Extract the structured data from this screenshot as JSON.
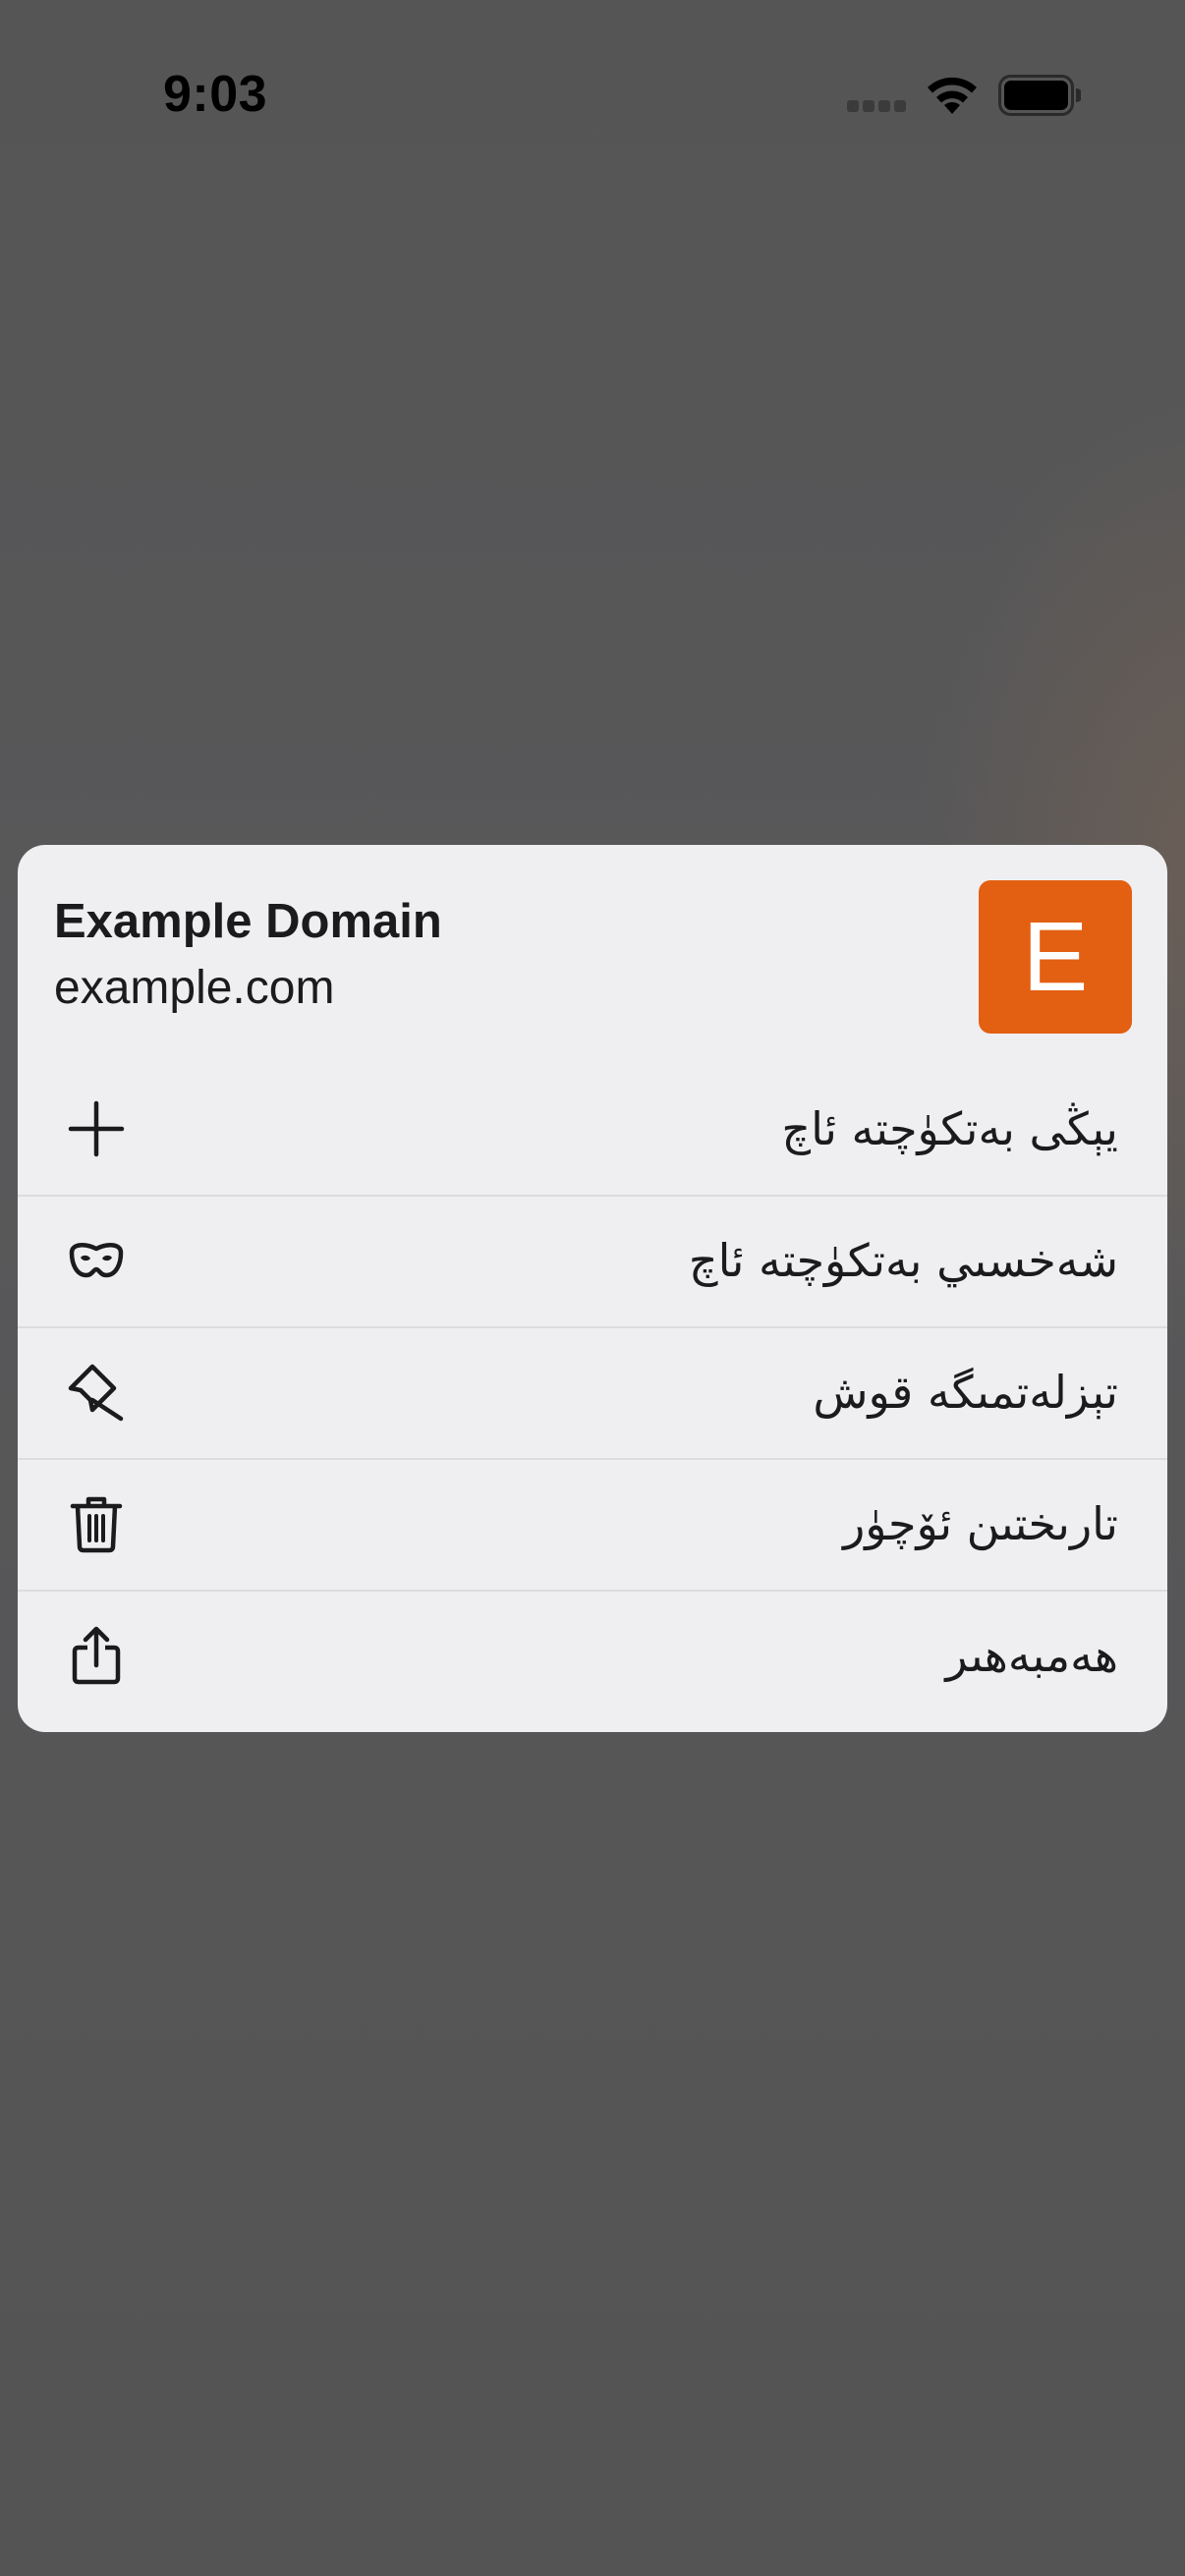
{
  "status_bar": {
    "time": "9:03",
    "icons": [
      "cellular-signal-icon",
      "wifi-icon",
      "battery-icon"
    ]
  },
  "menu": {
    "site_title": "Example Domain",
    "site_domain": "example.com",
    "favicon_letter": "E",
    "favicon_color": "#e35f12",
    "items": [
      {
        "label": "يېڭى بەتكۈچتە ئاچ",
        "icon": "plus-icon"
      },
      {
        "label": "شەخسىي بەتكۈچتە ئاچ",
        "icon": "private-mask-icon"
      },
      {
        "label": "تېزلەتمىگە قوش",
        "icon": "pin-icon"
      },
      {
        "label": "تارىختىن ئۆچۈر",
        "icon": "trash-icon"
      },
      {
        "label": "ھەمبەھىر",
        "icon": "share-icon"
      }
    ]
  },
  "colors": {
    "backdrop": "#555556",
    "menu_background": "#efeff1",
    "text": "#1b1b1d"
  }
}
